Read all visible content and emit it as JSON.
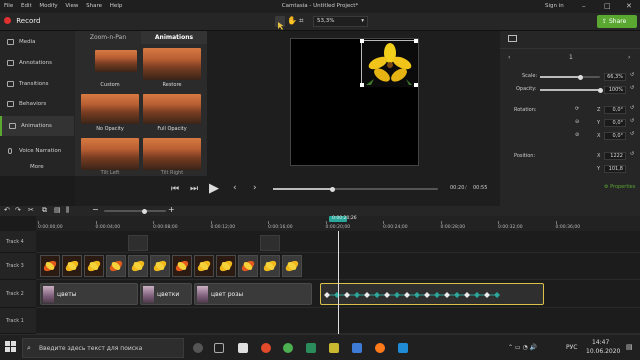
{
  "app": {
    "title": "Camtasia - Untitled Project*",
    "menu": [
      "File",
      "Edit",
      "Modify",
      "View",
      "Share",
      "Help"
    ],
    "sign_in": "Sign in"
  },
  "toolbar": {
    "record_label": "Record",
    "zoom_value": "53,3%",
    "share_label": "Share"
  },
  "sidebar": {
    "items": [
      {
        "label": "Media",
        "icon": "media-icon"
      },
      {
        "label": "Annotations",
        "icon": "annotations-icon"
      },
      {
        "label": "Transitions",
        "icon": "transitions-icon"
      },
      {
        "label": "Behaviors",
        "icon": "behaviors-icon"
      },
      {
        "label": "Animations",
        "icon": "animations-icon"
      },
      {
        "label": "Voice Narration",
        "icon": "microphone-icon"
      }
    ],
    "more_label": "More"
  },
  "panel": {
    "tabs": [
      "Zoom-n-Pan",
      "Animations"
    ],
    "thumbs": [
      {
        "label": "Custom"
      },
      {
        "label": "Restore"
      },
      {
        "label": "No Opacity"
      },
      {
        "label": "Full Opacity"
      },
      {
        "label": "Tilt Left"
      },
      {
        "label": "Tilt Right"
      }
    ]
  },
  "properties": {
    "page_number": "1",
    "scale_label": "Scale:",
    "scale_value": "66,3%",
    "scale_fraction": 0.66,
    "opacity_label": "Opacity:",
    "opacity_value": "100%",
    "opacity_fraction": 1.0,
    "rotation_label": "Rotation:",
    "rot_z_axis": "Z",
    "rot_z": "0,0°",
    "rot_y_axis": "Y",
    "rot_y": "0,0°",
    "rot_x_axis": "X",
    "rot_x": "0,0°",
    "position_label": "Position:",
    "pos_x_axis": "X",
    "pos_x": "1222",
    "pos_y_axis": "Y",
    "pos_y": "101,8",
    "properties_button": "Properties"
  },
  "playback": {
    "current_time": "00:20",
    "total_time": "00:55",
    "progress_fraction": 0.36
  },
  "ruler": {
    "playhead_time": "0:00:20;26",
    "ticks": [
      "0:00:00;00",
      "0:00:04;00",
      "0:00:08;00",
      "0:00:12;00",
      "0:00:16;00",
      "0:00:20;00",
      "0:00:24;00",
      "0:00:28;00",
      "0:00:32;00",
      "0:00:36;00"
    ]
  },
  "tracks": [
    {
      "name": "Track 4"
    },
    {
      "name": "Track 3"
    },
    {
      "name": "Track 2"
    },
    {
      "name": "Track 1"
    }
  ],
  "clips": {
    "flowers": "цветы",
    "flower_small": "цветки",
    "rose_color": "цвет розы"
  },
  "taskbar": {
    "search_placeholder": "Введите здесь текст для поиска",
    "language": "РУС",
    "time": "14:47",
    "date": "10.06.2020"
  },
  "colors": {
    "accent_green": "#5aa832",
    "record_red": "#e03030",
    "selection_yellow": "#d8c04a",
    "keyframe_teal": "#2aa79b"
  }
}
